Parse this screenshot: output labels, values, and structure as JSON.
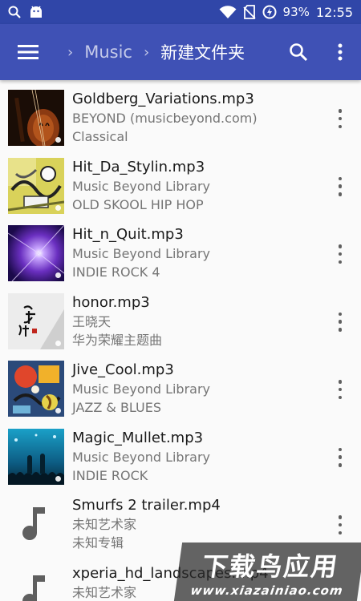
{
  "status_bar": {
    "battery": "93%",
    "time": "12:55",
    "icons": [
      "search-icon",
      "android-icon",
      "wifi-icon",
      "no-sim-icon",
      "battery-saver-icon"
    ]
  },
  "toolbar": {
    "menu_icon": "hamburger-menu-icon",
    "crumbs": [
      "Music",
      "新建文件夹"
    ],
    "search_icon": "search-icon",
    "overflow_icon": "more-vert-icon"
  },
  "colors": {
    "status_bar": "#3046a8",
    "toolbar": "#3f51b5",
    "title_text": "#1a1a1a",
    "subtitle_text": "#757575"
  },
  "items": [
    {
      "title": "Goldberg_Variations.mp3",
      "artist": "BEYOND (musicbeyond.com)",
      "album": "Classical",
      "art": "violin"
    },
    {
      "title": "Hit_Da_Stylin.mp3",
      "artist": "Music Beyond Library",
      "album": "OLD SKOOL HIP HOP",
      "art": "graffiti"
    },
    {
      "title": "Hit_n_Quit.mp3",
      "artist": "Music Beyond Library",
      "album": "INDIE ROCK 4",
      "art": "light-burst"
    },
    {
      "title": "honor.mp3",
      "artist": "王晓天",
      "album": "华为荣耀主题曲",
      "art": "calligraphy"
    },
    {
      "title": "Jive_Cool.mp3",
      "artist": "Music Beyond Library",
      "album": "JAZZ & BLUES",
      "art": "jazz-collage"
    },
    {
      "title": "Magic_Mullet.mp3",
      "artist": "Music Beyond Library",
      "album": "INDIE ROCK",
      "art": "concert"
    },
    {
      "title": "Smurfs 2 trailer.mp4",
      "artist": "未知艺术家",
      "album": "未知专辑",
      "art": "music-note"
    },
    {
      "title": "xperia_hd_landscapes.mp4",
      "artist": "未知艺术家",
      "album": "",
      "art": "music-note"
    }
  ],
  "watermark": {
    "main": "下载鸟应用",
    "url": "www.xiazainiao.com"
  }
}
